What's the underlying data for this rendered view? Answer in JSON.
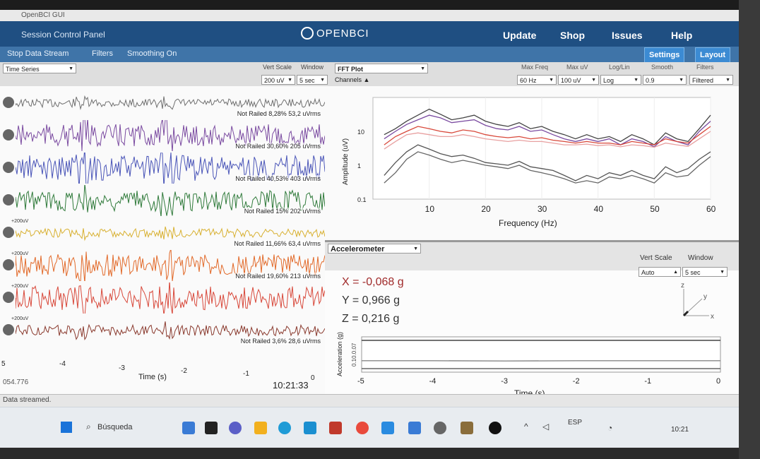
{
  "window": {
    "title": "OpenBCI GUI"
  },
  "header": {
    "session_label": "Session Control Panel",
    "logo": "OPENBCI",
    "nav": [
      "Update",
      "Shop",
      "Issues",
      "Help"
    ]
  },
  "subbar": {
    "buttons": [
      "Stop Data Stream",
      "Filters",
      "Smoothing On"
    ],
    "right_buttons": [
      "Settings",
      "Layout"
    ]
  },
  "time_series": {
    "tab": "Time Series",
    "vert_scale_label": "Vert Scale",
    "window_label": "Window",
    "vert_scale": "200 uV",
    "window": "5 sec",
    "channels": [
      {
        "status": "Not Railed 8,28% 53,2 uVrms",
        "scale": "",
        "color": "#707070"
      },
      {
        "status": "Not Railed 30,60% 205 uVrms",
        "scale": "",
        "color": "#7a4aa0"
      },
      {
        "status": "Not Railed 40,53% 403 uVrms",
        "scale": "",
        "color": "#4a55b8"
      },
      {
        "status": "Not Railed 15% 202 uVrms",
        "scale": "",
        "color": "#2f7a3a"
      },
      {
        "status": "Not Railed 11,66% 63,4 uVrms",
        "scale": "+200uV",
        "color": "#d8b030"
      },
      {
        "status": "Not Railed 19,60% 213 uVrms",
        "scale": "+200uV",
        "color": "#e26a2a"
      },
      {
        "status": "",
        "scale": "+200uV",
        "color": "#d8483a"
      },
      {
        "status": "Not Railed 3,6% 28,6 uVrms",
        "scale": "+200uV",
        "color": "#8a3a2e"
      }
    ],
    "x_ticks": [
      "5",
      "-4",
      "-3",
      "-2",
      "-1",
      "0"
    ],
    "xlabel": "Time (s)",
    "left_readout": "054.776",
    "clock": "10:21:33",
    "status": "Data streamed."
  },
  "fft": {
    "tab": "FFT Plot",
    "channels_label": "Channels",
    "controls": [
      {
        "label": "Max Freq",
        "value": "60 Hz"
      },
      {
        "label": "Max uV",
        "value": "100 uV"
      },
      {
        "label": "Log/Lin",
        "value": "Log"
      },
      {
        "label": "Smooth",
        "value": "0.9"
      },
      {
        "label": "Filters",
        "value": "Filtered"
      }
    ]
  },
  "accelerometer": {
    "tab": "Accelerometer",
    "vert_scale_label": "Vert Scale",
    "window_label": "Window",
    "vert_scale": "Auto",
    "window": "5 sec",
    "x": "X = -0,068 g",
    "y": "Y = 0,966 g",
    "z": "Z = 0,216 g",
    "axes_3d": [
      "z",
      "y",
      "x"
    ],
    "x_ticks": [
      "-5",
      "-4",
      "-3",
      "-2",
      "-1",
      "0"
    ]
  },
  "taskbar": {
    "search": "Búsqueda",
    "lang": "ESP",
    "time": "10:21"
  },
  "colors": {
    "header": "#1f4f82",
    "subbar": "#3f74a8",
    "accent": "#3c8bd3"
  },
  "chart_data": [
    {
      "type": "line",
      "title": "",
      "xlabel": "Frequency (Hz)",
      "ylabel": "Amplitude (uV)",
      "xlim": [
        0,
        60
      ],
      "ylim": [
        0.1,
        100
      ],
      "yscale": "log",
      "x_ticks": [
        10,
        20,
        30,
        40,
        50,
        60
      ],
      "y_ticks": [
        "0.1",
        "1",
        "10"
      ],
      "x": [
        2,
        4,
        6,
        8,
        10,
        12,
        14,
        16,
        18,
        20,
        22,
        24,
        26,
        28,
        30,
        32,
        34,
        36,
        38,
        40,
        42,
        44,
        46,
        48,
        50,
        52,
        54,
        56,
        58,
        60
      ],
      "series": [
        {
          "color": "#444444",
          "values": [
            8,
            12,
            20,
            30,
            45,
            32,
            22,
            25,
            30,
            20,
            16,
            14,
            18,
            12,
            14,
            10,
            8,
            6,
            8,
            6,
            7,
            5,
            8,
            6,
            4,
            9,
            6,
            5,
            12,
            30
          ]
        },
        {
          "color": "#7a4aa0",
          "values": [
            6,
            10,
            16,
            22,
            30,
            25,
            18,
            20,
            22,
            15,
            12,
            11,
            14,
            10,
            11,
            8,
            6,
            5,
            6,
            5,
            6,
            4,
            6,
            5,
            3.5,
            7,
            5,
            4,
            10,
            20
          ]
        },
        {
          "color": "#d8483a",
          "values": [
            4,
            7,
            10,
            14,
            12,
            10,
            9,
            11,
            10,
            8,
            7,
            6.5,
            7,
            6,
            6.5,
            5.5,
            5,
            4.5,
            5,
            4.5,
            4.5,
            4,
            5,
            4.5,
            4,
            6,
            5,
            4.5,
            8,
            14
          ]
        },
        {
          "color": "#e8a0a0",
          "values": [
            3,
            5,
            8,
            9,
            8,
            7,
            7,
            8,
            7,
            6,
            5.5,
            5,
            5.5,
            5,
            5,
            4.5,
            4,
            4,
            4.2,
            3.8,
            4,
            3.5,
            4,
            3.8,
            3.4,
            4.5,
            4,
            3.6,
            6,
            10
          ]
        },
        {
          "color": "#555555",
          "values": [
            0.5,
            1.2,
            2.5,
            4,
            3,
            2.2,
            1.8,
            2,
            1.6,
            1.2,
            1.1,
            1,
            1.3,
            0.9,
            0.8,
            0.7,
            0.5,
            0.35,
            0.5,
            0.4,
            0.6,
            0.5,
            0.7,
            0.5,
            0.4,
            0.9,
            0.6,
            0.8,
            1.5,
            2.5
          ]
        },
        {
          "color": "#666666",
          "values": [
            0.3,
            0.6,
            1.5,
            2.5,
            2,
            1.5,
            1.2,
            1.4,
            1.2,
            1,
            0.9,
            0.8,
            1,
            0.7,
            0.6,
            0.5,
            0.4,
            0.3,
            0.35,
            0.3,
            0.45,
            0.4,
            0.5,
            0.4,
            0.3,
            0.6,
            0.45,
            0.5,
            1,
            1.8
          ]
        }
      ]
    },
    {
      "type": "line",
      "title": "",
      "xlabel": "Time (s)",
      "ylabel": "Acceleration (g)",
      "xlim": [
        -5,
        0
      ],
      "y_tick_text": "0.10.0.07",
      "series": [
        {
          "color": "#444444",
          "values": [
            0.97,
            0.97,
            0.97,
            0.97,
            0.97,
            0.97
          ]
        },
        {
          "color": "#888888",
          "values": [
            0.22,
            0.22,
            0.21,
            0.22,
            0.22,
            0.22
          ]
        },
        {
          "color": "#666666",
          "values": [
            -0.07,
            -0.07,
            -0.07,
            -0.07,
            -0.07,
            -0.07
          ]
        }
      ],
      "x": [
        -5,
        -4,
        -3,
        -2,
        -1,
        0
      ]
    }
  ]
}
